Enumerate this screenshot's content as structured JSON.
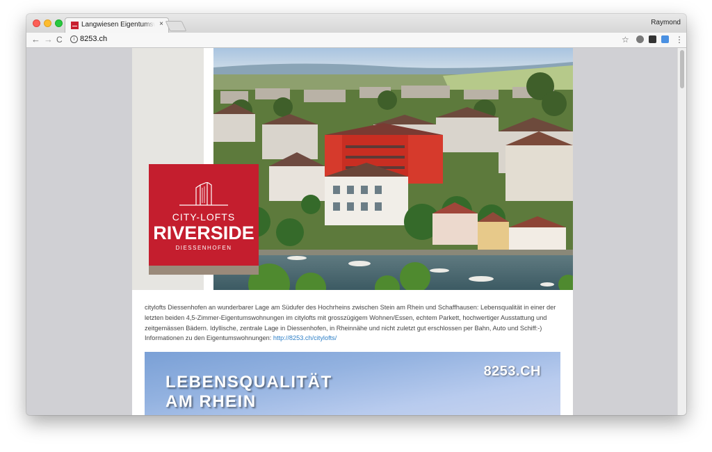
{
  "browser": {
    "tab_title": "Langwiesen Eigentumswohnungen",
    "tab_close": "×",
    "profile_name": "Raymond",
    "url": "8253.ch",
    "nav": {
      "back": "←",
      "forward": "→",
      "reload": "C"
    },
    "info_icon": "i",
    "star": "☆",
    "menu": "⋮"
  },
  "logo": {
    "line1": "CITY-LOFTS",
    "line2": "RIVERSIDE",
    "line3": "DIESSENHOFEN",
    "color": "#c41e2e"
  },
  "description": {
    "text": "citylofts Diessenhofen an wunderbarer Lage am Südufer des Hochrheins zwischen Stein am Rhein und Schaffhausen: Lebensqualität in einer der letzten beiden 4,5-Zimmer-Eigentumswohnungen im citylofts mit grosszügigem Wohnen/Essen, echtem Parkett, hochwertiger Ausstattung und zeitgemässen Bädern. Idyllische, zentrale Lage in Diessenhofen, in Rheinnähe und nicht zuletzt gut erschlossen per Bahn, Auto und Schiff:-) Informationen zu den Eigentumswohnungen: ",
    "link": "http://8253.ch/citylofts/"
  },
  "banner": {
    "domain": "8253.CH",
    "headline_1": "LEBENSQUALITÄT",
    "headline_2": "AM RHEIN"
  }
}
